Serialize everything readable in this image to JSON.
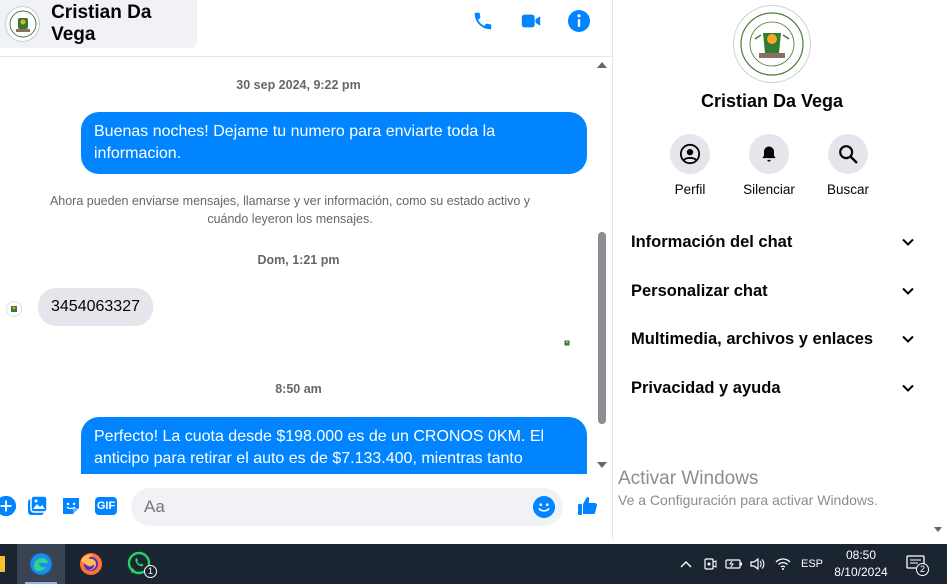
{
  "header": {
    "contact_name": "Cristian Da Vega"
  },
  "messages": {
    "ts1": "30 sep 2024, 9:22 pm",
    "out1": "Buenas noches! Dejame tu numero para enviarte toda la informacion.",
    "system": "Ahora pueden enviarse mensajes, llamarse y ver información, como su estado activo y cuándo leyeron los mensajes.",
    "ts2": "Dom, 1:21 pm",
    "in1": "3454063327",
    "ts3": "8:50 am",
    "out2": "Perfecto! La cuota desde $198.000 es de un CRONOS 0KM. El anticipo para retirar el auto es de $7.133.400, mientras tanto"
  },
  "composer": {
    "placeholder": "Aa",
    "gif_label": "GIF"
  },
  "panel": {
    "name": "Cristian Da Vega",
    "actions": [
      {
        "label": "Perfil"
      },
      {
        "label": "Silenciar"
      },
      {
        "label": "Buscar"
      }
    ],
    "sections": [
      {
        "label": "Información del chat"
      },
      {
        "label": "Personalizar chat"
      },
      {
        "label": "Multimedia, archivos y enlaces"
      },
      {
        "label": "Privacidad y ayuda"
      }
    ]
  },
  "watermark": {
    "title": "Activar Windows",
    "subtitle": "Ve a Configuración para activar Windows."
  },
  "taskbar": {
    "whatsapp_badge": "1",
    "language": "ESP",
    "time": "08:50",
    "date": "8/10/2024",
    "notif_count": "2"
  },
  "colors": {
    "accent": "#0084ff",
    "bubble_in": "#e4e6eb",
    "taskbar": "#1b2431"
  }
}
